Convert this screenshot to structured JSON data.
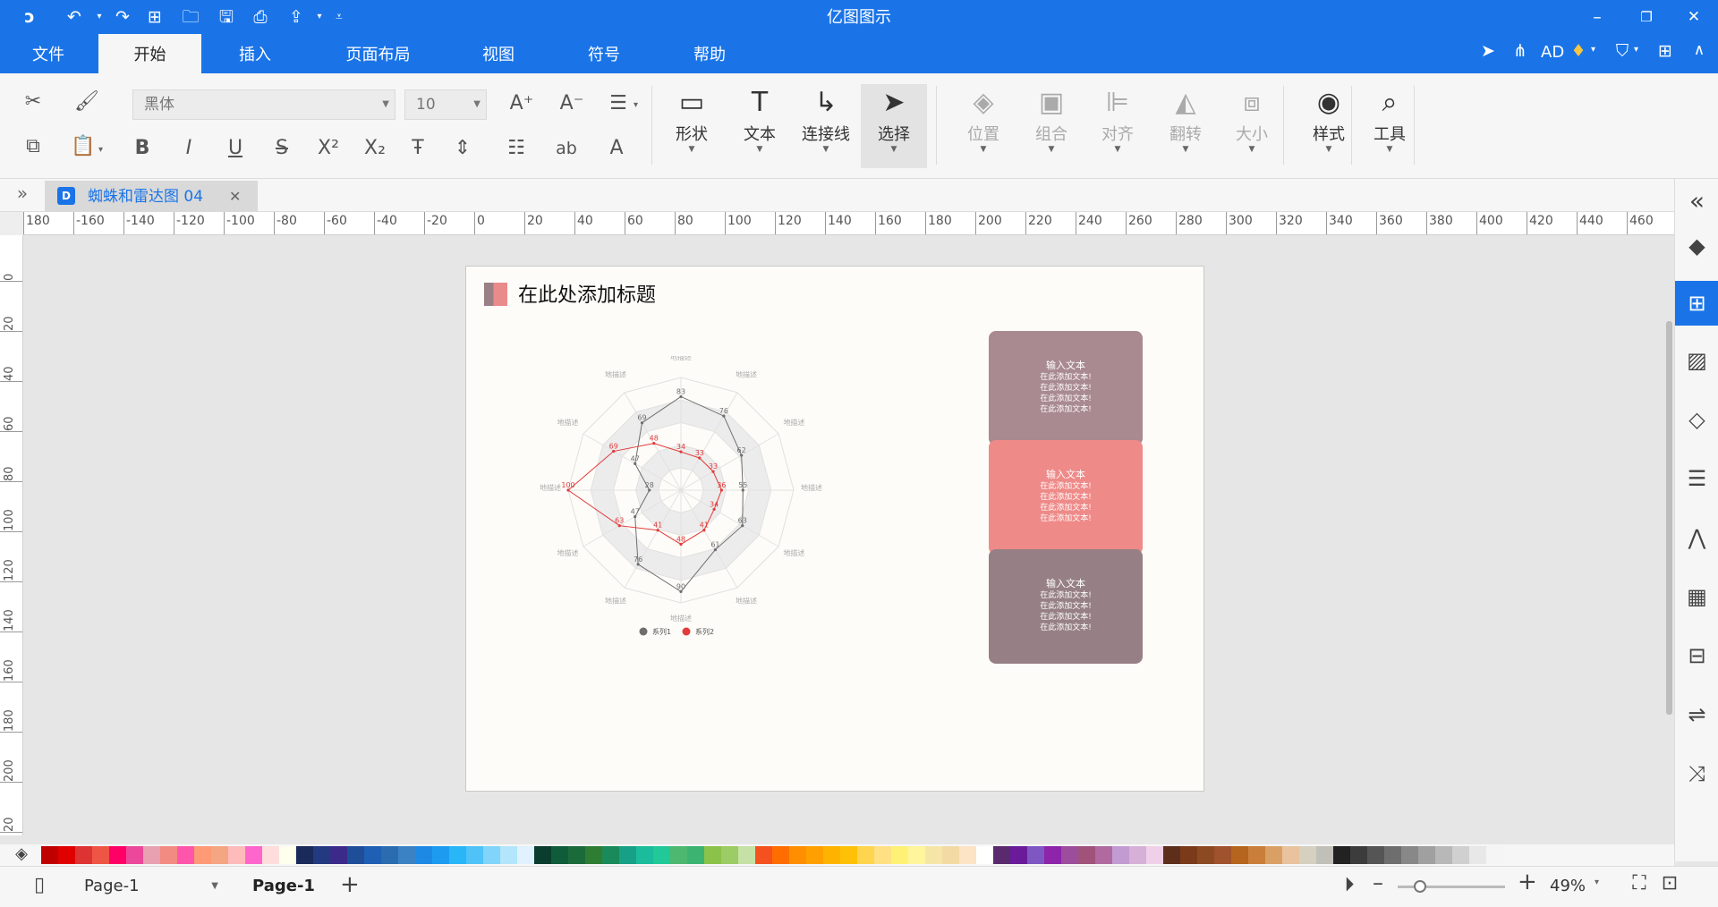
{
  "app": {
    "title": "亿图图示",
    "qa_icons": [
      "logo-icon",
      "undo-icon",
      "redo-icon",
      "new-icon",
      "open-icon",
      "save-icon",
      "print-icon",
      "export-icon",
      "customize-icon"
    ],
    "window_controls": {
      "minimize": "–",
      "restore": "❐",
      "close": "✕"
    }
  },
  "menu": {
    "tabs": [
      "文件",
      "开始",
      "插入",
      "页面布局",
      "视图",
      "符号",
      "帮助"
    ],
    "active_tab": "开始",
    "right_text": "AD"
  },
  "ribbon": {
    "font_name": "黑体",
    "font_size": "10",
    "big_buttons": [
      {
        "label": "形状",
        "icon": "▭",
        "name": "shape",
        "disabled": false
      },
      {
        "label": "文本",
        "icon": "T",
        "name": "text",
        "disabled": false
      },
      {
        "label": "连接线",
        "icon": "↳",
        "name": "connector",
        "disabled": false
      },
      {
        "label": "选择",
        "icon": "➤",
        "name": "select",
        "disabled": false
      },
      {
        "label": "位置",
        "icon": "◈",
        "name": "position",
        "disabled": true
      },
      {
        "label": "组合",
        "icon": "▣",
        "name": "group",
        "disabled": true
      },
      {
        "label": "对齐",
        "icon": "⊫",
        "name": "align",
        "disabled": true
      },
      {
        "label": "翻转",
        "icon": "◭",
        "name": "flip",
        "disabled": true
      },
      {
        "label": "大小",
        "icon": "⧈",
        "name": "size",
        "disabled": true
      },
      {
        "label": "样式",
        "icon": "◉",
        "name": "style",
        "disabled": false
      },
      {
        "label": "工具",
        "icon": "⌕",
        "name": "tools",
        "disabled": false
      }
    ]
  },
  "document": {
    "tab_name": "蜘蛛和雷达图 04",
    "page_title": "在此处添加标题"
  },
  "cards": [
    {
      "title": "输入文本",
      "lines": [
        "在此添加文本!",
        "在此添加文本!",
        "在此添加文本!",
        "在此添加文本!"
      ],
      "color": "#a88a90"
    },
    {
      "title": "输入文本",
      "lines": [
        "在此添加文本!",
        "在此添加文本!",
        "在此添加文本!",
        "在此添加文本!"
      ],
      "color": "#ee8a88"
    },
    {
      "title": "输入文本",
      "lines": [
        "在此添加文本!",
        "在此添加文本!",
        "在此添加文本!",
        "在此添加文本!"
      ],
      "color": "#968086"
    }
  ],
  "chart_data": {
    "type": "radar",
    "axes_count": 12,
    "axis_label": "地描述",
    "rmax": 100,
    "rings": 5,
    "series": [
      {
        "name": "系列1",
        "color": "#6e6e6e",
        "values": [
          83,
          76,
          62,
          55,
          63,
          61,
          90,
          76,
          47,
          28,
          47,
          69
        ]
      },
      {
        "name": "系列2",
        "color": "#e23b3b",
        "values": [
          34,
          33,
          33,
          36,
          34,
          41,
          48,
          41,
          63,
          100,
          69,
          48
        ]
      }
    ],
    "legend_position": "bottom"
  },
  "rulers": {
    "h_ticks": [
      "180",
      "-160",
      "-140",
      "-120",
      "-100",
      "-80",
      "-60",
      "-40",
      "-20",
      "0",
      "20",
      "40",
      "60",
      "80",
      "100",
      "120",
      "140",
      "160",
      "180",
      "200",
      "220",
      "240",
      "260",
      "280",
      "300",
      "320",
      "340",
      "360",
      "380",
      "400",
      "420",
      "440",
      "460"
    ],
    "v_ticks": [
      "0",
      "20",
      "40",
      "60",
      "80",
      "100",
      "120",
      "140",
      "160",
      "180",
      "200",
      "20"
    ]
  },
  "palette": [
    "#c00000",
    "#e00000",
    "#d33",
    "#e54",
    "#f06",
    "#ec4899",
    "#e7a1b0",
    "#f28b82",
    "#f5a",
    "#ff9a76",
    "#f4a582",
    "#fbb",
    "#f6c",
    "#fdd",
    "#ffe",
    "#1a2a5a",
    "#243a80",
    "#3b2a8a",
    "#1f4e99",
    "#1f5fb4",
    "#2b6cb0",
    "#3b82c4",
    "#1e88e5",
    "#1d9bf0",
    "#29b6f6",
    "#4fc3f7",
    "#81d4fa",
    "#b3e5fc",
    "#e0f2fe",
    "#0b3d2e",
    "#0e5c3a",
    "#1b6b3a",
    "#2e7d32",
    "#1b8a5a",
    "#16a085",
    "#1abc9c",
    "#20c997",
    "#4db86f",
    "#3cb371",
    "#8bc34a",
    "#9ccc65",
    "#c5e1a5",
    "#f4511e",
    "#ff6d00",
    "#ff8f00",
    "#ffa000",
    "#ffb300",
    "#ffc107",
    "#ffd54f",
    "#ffe082",
    "#fff176",
    "#fff59d",
    "#f5e6a8",
    "#f3d9a4",
    "#fce4c4",
    "#ffffff",
    "#5b2a6e",
    "#6a1b9a",
    "#7e57c2",
    "#8e24aa",
    "#9c4d9c",
    "#a0527a",
    "#b06aa0",
    "#c39bd3",
    "#d7b0d8",
    "#efd0e8",
    "#5d2e1a",
    "#7b3a1a",
    "#8d4a22",
    "#a0522d",
    "#b5651d",
    "#c97f3a",
    "#d9a066",
    "#e8c39e",
    "#d5d0c0",
    "#c0c0b8",
    "#222222",
    "#3c3c3c",
    "#555555",
    "#6e6e6e",
    "#888888",
    "#a0a0a0",
    "#b8b8b8",
    "#d0d0d0",
    "#e8e8e8",
    "#f5f5f5"
  ],
  "status": {
    "page_select": "Page-1",
    "page_tab": "Page-1",
    "add": "+",
    "zoom": "49%"
  }
}
